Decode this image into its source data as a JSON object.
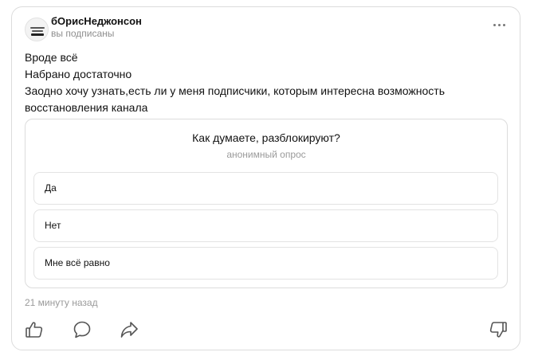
{
  "post": {
    "author": "бОрисНеджонсон",
    "subscription_status": "вы подписаны",
    "text_lines": [
      "Вроде всё",
      "Набрано достаточно",
      "Заодно хочу узнать,есть ли у меня подписчики, которым интересна возможность",
      "восстановления канала"
    ],
    "timestamp": "21 минуту назад"
  },
  "poll": {
    "question": "Как думаете, разблокируют?",
    "type": "анонимный опрос",
    "options": [
      "Да",
      "Нет",
      "Мне всё равно"
    ]
  },
  "icons": {
    "more": "more-dots-icon",
    "like": "thumbs-up-icon",
    "comment": "comment-bubble-icon",
    "share": "share-arrow-icon",
    "dislike": "thumbs-down-icon"
  },
  "colors": {
    "border": "#dcdcdc",
    "muted_text": "#8e8e8e",
    "icon_stroke": "#555555"
  }
}
